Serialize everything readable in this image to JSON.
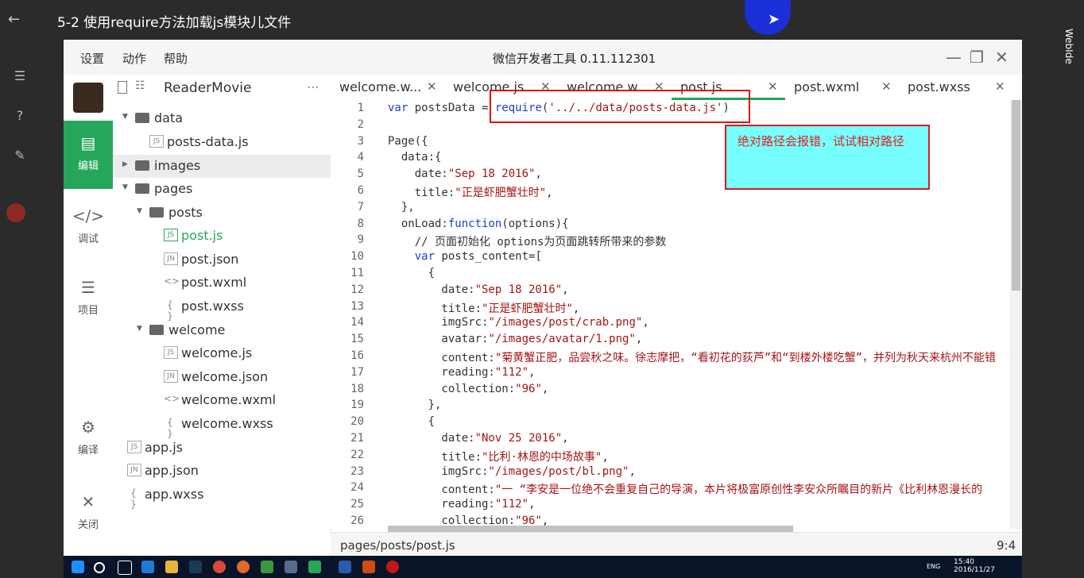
{
  "player": {
    "title": "5-2 使用require方法加载js模块儿文件",
    "right_label": "WebIde"
  },
  "window": {
    "menu": [
      "设置",
      "动作",
      "帮助"
    ],
    "title": "微信开发者工具 0.11.112301"
  },
  "activity": [
    {
      "label": "编辑",
      "icon": "code-icon"
    },
    {
      "label": "调试",
      "icon": "debug-icon"
    },
    {
      "label": "项目",
      "icon": "list-icon"
    },
    {
      "label": "编译",
      "icon": "compile-icon"
    },
    {
      "label": "关闭",
      "icon": "close-icon"
    }
  ],
  "tree": {
    "project": "ReaderMovie",
    "items": [
      {
        "name": "data",
        "type": "folder"
      },
      {
        "name": "posts-data.js",
        "type": "JS"
      },
      {
        "name": "images",
        "type": "folder"
      },
      {
        "name": "pages",
        "type": "folder"
      },
      {
        "name": "posts",
        "type": "folder"
      },
      {
        "name": "post.js",
        "type": "JS"
      },
      {
        "name": "post.json",
        "type": "JN"
      },
      {
        "name": "post.wxml",
        "type": "<>"
      },
      {
        "name": "post.wxss",
        "type": "{}"
      },
      {
        "name": "welcome",
        "type": "folder"
      },
      {
        "name": "welcome.js",
        "type": "JS"
      },
      {
        "name": "welcome.json",
        "type": "JN"
      },
      {
        "name": "welcome.wxml",
        "type": "<>"
      },
      {
        "name": "welcome.wxss",
        "type": "{}"
      },
      {
        "name": "app.js",
        "type": "JS"
      },
      {
        "name": "app.json",
        "type": "JN"
      },
      {
        "name": "app.wxss",
        "type": "{}"
      }
    ]
  },
  "tabs": [
    "welcome.w...",
    "welcome.js",
    "welcome.w...",
    "post.js",
    "post.wxml",
    "post.wxss"
  ],
  "code": {
    "line_numbers": [
      "1",
      "2",
      "3",
      "4",
      "5",
      "6",
      "7",
      "8",
      "9",
      "10",
      "11",
      "12",
      "13",
      "14",
      "15",
      "16",
      "17",
      "18",
      "19",
      "20",
      "21",
      "22",
      "23",
      "24",
      "25",
      "26"
    ],
    "lines": [
      "var postsData = require('../../data/posts-data.js')",
      "",
      "Page({",
      "  data:{",
      "    date:\"Sep 18 2016\",",
      "    title:\"正是虾肥蟹壮时\",",
      "  },",
      "  onLoad:function(options){",
      "    // 页面初始化 options为页面跳转所带来的参数",
      "    var posts_content=[",
      "      {",
      "        date:\"Sep 18 2016\",",
      "        title:\"正是虾肥蟹壮时\",",
      "        imgSrc:\"/images/post/crab.png\",",
      "        avatar:\"/images/avatar/1.png\",",
      "        content:\"菊黄蟹正肥，品尝秋之味。徐志摩把，“看初花的荻芦”和“到楼外楼吃蟹”，并列为秋天来杭州不能错",
      "        reading:\"112\",",
      "        collection:\"96\",",
      "      },",
      "      {",
      "        date:\"Nov 25 2016\",",
      "        title:\"比利·林恩的中场故事\",",
      "        imgSrc:\"/images/post/bl.png\",",
      "        content:\"一 “李安是一位绝不会重复自己的导演，本片将极富原创性李安众所瞩目的新片《比利林恩漫长的",
      "        reading:\"112\",",
      "        collection:\"96\","
    ]
  },
  "annotation": {
    "note": "绝对路径会报错，试试相对路径"
  },
  "status": {
    "path": "pages/posts/post.js",
    "position": "9:4"
  },
  "taskbar": {
    "lang": "ENG",
    "time": "15:40",
    "date": "2016/11/27"
  }
}
